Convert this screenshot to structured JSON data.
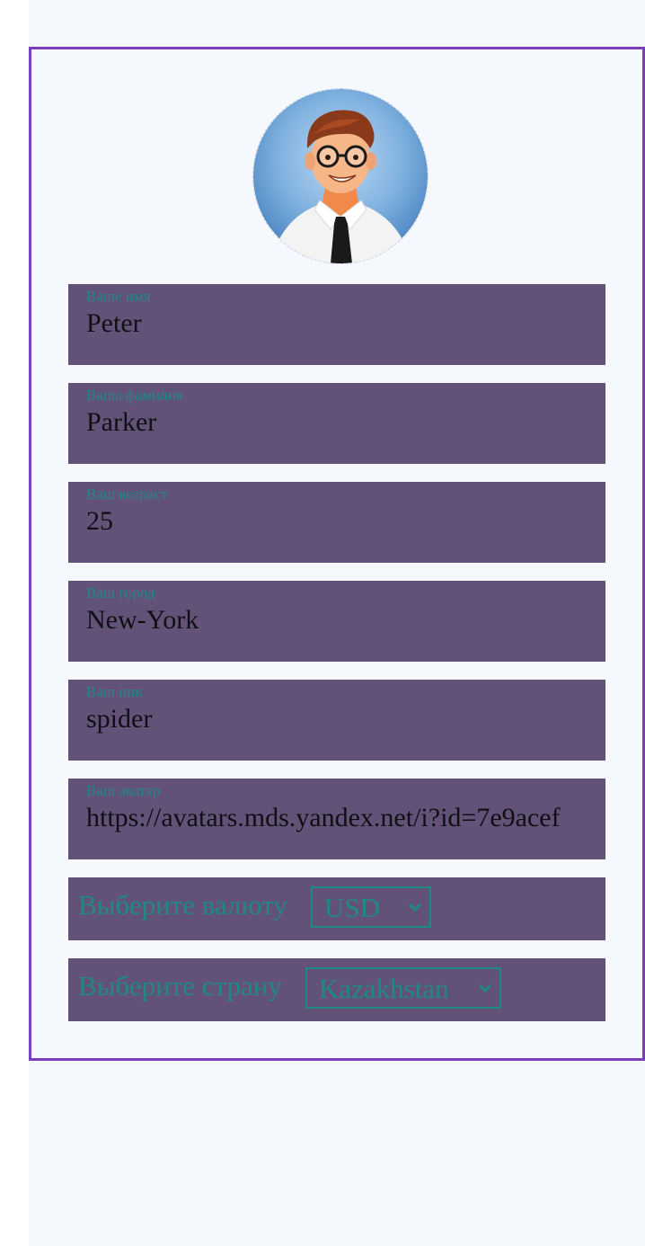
{
  "profile": {
    "avatar_icon": "avatar-icon",
    "fields": [
      {
        "label": "Ваше имя",
        "value": "Peter"
      },
      {
        "label": "Ваша фамилия",
        "value": "Parker"
      },
      {
        "label": "Ваш возраст",
        "value": "25"
      },
      {
        "label": "Ваш город",
        "value": "New-York"
      },
      {
        "label": "Ваш ник",
        "value": "spider"
      },
      {
        "label": "Ваш аватар",
        "value": "https://avatars.mds.yandex.net/i?id=7e9acef"
      }
    ],
    "currency": {
      "label": "Выберите валюту",
      "selected": "USD"
    },
    "country": {
      "label": "Выберите страну",
      "selected": "Kazakhstan"
    }
  },
  "colors": {
    "card_border": "#7a3fc0",
    "field_bg": "#625278",
    "label_teal": "#1f8a82",
    "page_bg": "#f5f8fd"
  }
}
